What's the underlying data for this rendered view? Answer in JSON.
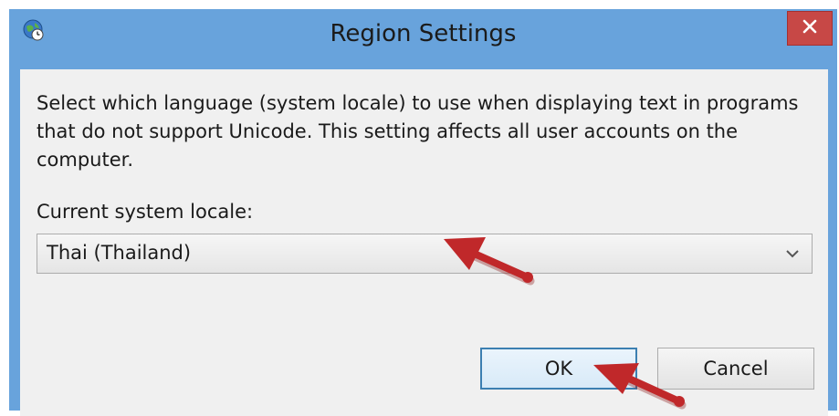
{
  "window": {
    "title": "Region Settings",
    "close_glyph": "✕",
    "icon": "globe-clock-icon"
  },
  "content": {
    "description": "Select which language (system locale) to use when displaying text in programs that do not support Unicode. This setting affects all user accounts on the computer.",
    "locale_label": "Current system locale:",
    "locale_value": "Thai (Thailand)",
    "dropdown_icon": "chevron-down-icon"
  },
  "buttons": {
    "ok_label": "OK",
    "cancel_label": "Cancel"
  },
  "annotations": {
    "arrow_color": "#c0282a"
  },
  "colors": {
    "titlebar": "#68a3dc",
    "close_button": "#c74846",
    "ok_border": "#3c7fb1"
  }
}
